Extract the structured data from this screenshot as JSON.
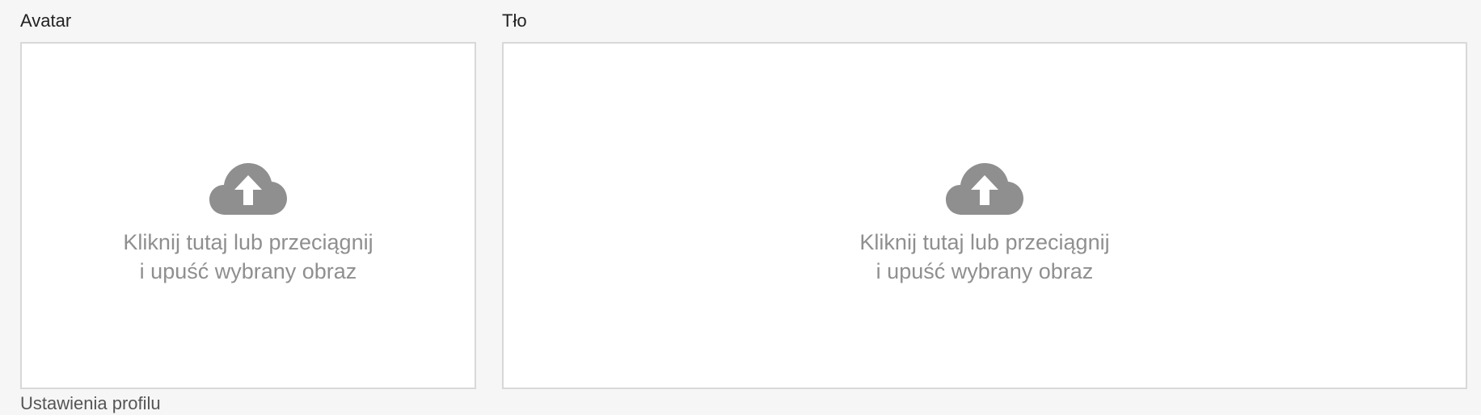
{
  "avatar": {
    "label": "Avatar",
    "dropzone_icon": "cloud-upload-icon",
    "dropzone_line1": "Kliknij tutaj lub przeciągnij",
    "dropzone_line2": "i upuść wybrany obraz"
  },
  "background": {
    "label": "Tło",
    "dropzone_icon": "cloud-upload-icon",
    "dropzone_line1": "Kliknij tutaj lub przeciągnij",
    "dropzone_line2": "i upuść wybrany obraz"
  },
  "hint": {
    "text": "Ustawienia profilu"
  },
  "colors": {
    "page_background": "#f6f6f6",
    "dropzone_background": "#ffffff",
    "dropzone_border": "#d8d8d8",
    "icon": "#8f8f8f",
    "hint_text": "#8f8f8f"
  }
}
